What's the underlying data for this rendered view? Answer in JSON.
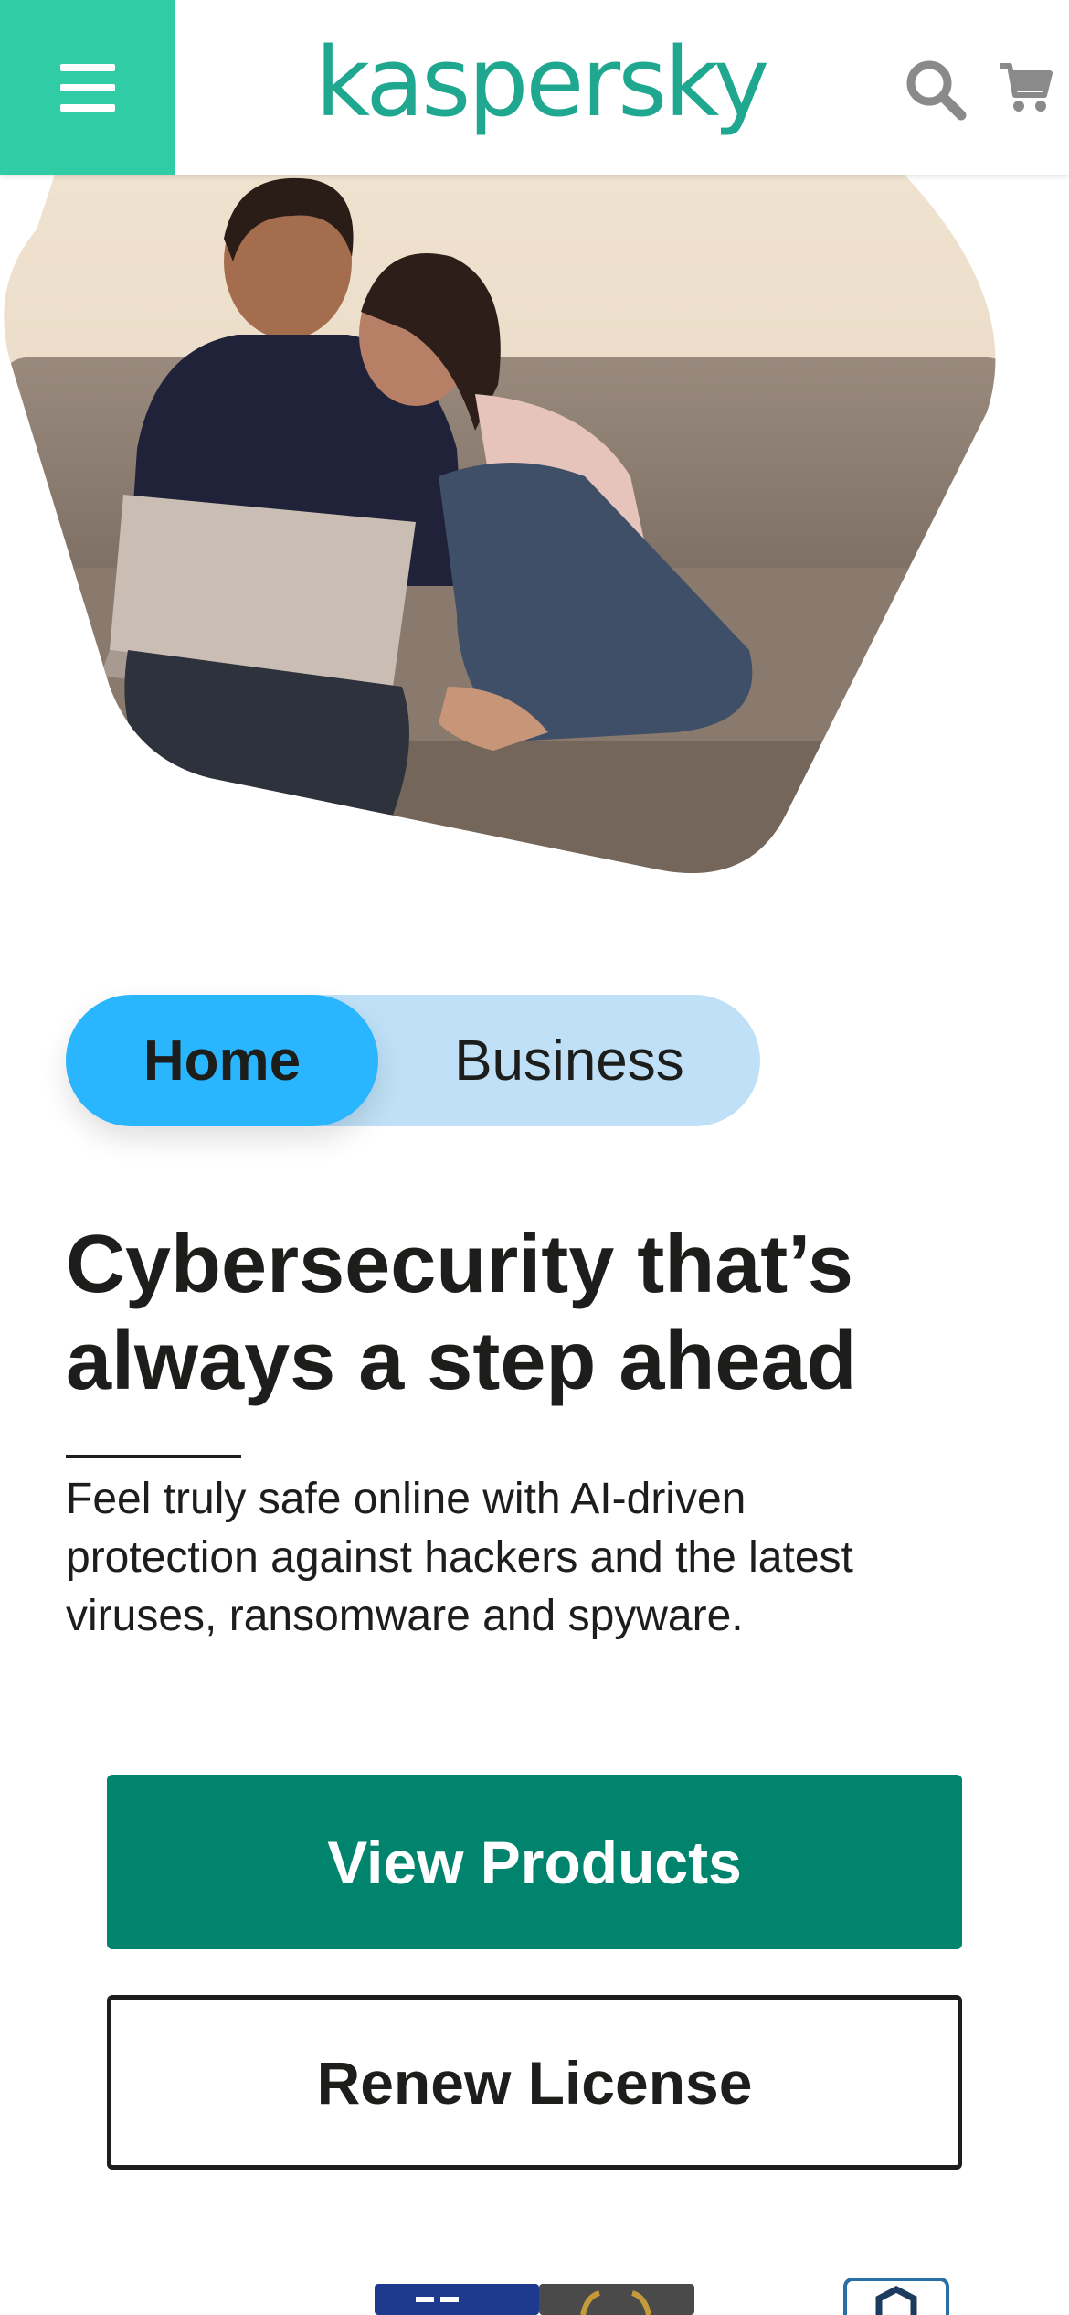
{
  "header": {
    "logo_text": "kaspersky",
    "menu_icon": "hamburger-menu-icon",
    "search_icon": "search-icon",
    "cart_icon": "shopping-cart-icon"
  },
  "hero": {
    "image_description_icon": "hero-photo"
  },
  "segment_toggle": {
    "home_label": "Home",
    "business_label": "Business",
    "selected": "Home"
  },
  "content": {
    "headline_line1": "Cybersecurity that’s",
    "headline_line2": "always a step ahead",
    "lead_line1": "Feel truly safe online with AI-driven",
    "lead_line2": "protection against hackers and the latest",
    "lead_line3": "viruses, ransomware and spyware."
  },
  "actions": {
    "primary_label": "View Products",
    "secondary_label": "Renew License"
  },
  "colors": {
    "brand_green": "#1fa88f",
    "menu_green": "#2fcca6",
    "primary_button": "#00846e",
    "toggle_active": "#29b6ff",
    "toggle_track": "#bfe0f7"
  }
}
